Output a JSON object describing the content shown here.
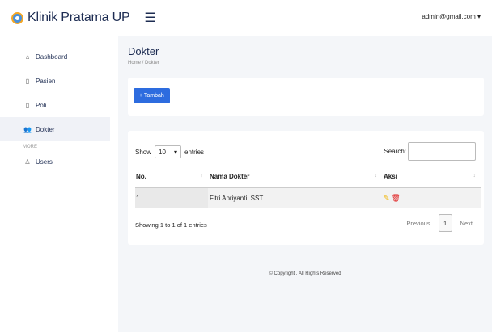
{
  "header": {
    "brand": "Klinik Pratama UP",
    "user": "admin@gmail.com ▾"
  },
  "sidebar": {
    "items": [
      {
        "label": "Dashboard",
        "icon": "home-icon"
      },
      {
        "label": "Pasien",
        "icon": "document-icon"
      },
      {
        "label": "Poli",
        "icon": "document-icon"
      },
      {
        "label": "Dokter",
        "icon": "users-icon"
      }
    ],
    "section": "MORE",
    "more_items": [
      {
        "label": "Users",
        "icon": "user-icon"
      }
    ]
  },
  "main": {
    "title": "Dokter",
    "breadcrumb": "Home  /  Dokter",
    "add_button": "+ Tambah",
    "show_label": "Show",
    "entries_value": "10",
    "entries_label": "entries",
    "search_label": "Search:",
    "table": {
      "headers": [
        "No.",
        "Nama Dokter",
        "Aksi"
      ],
      "rows": [
        {
          "no": "1",
          "name": "Fitri Apriyanti, SST"
        }
      ]
    },
    "info": "Showing 1 to 1 of 1 entries",
    "pagination": {
      "prev": "Previous",
      "current": "1",
      "next": "Next"
    }
  },
  "footer": "© Copyright . All Rights Reserved",
  "colors": {
    "primary": "#2d6cdf",
    "brand_text": "#1d2c52",
    "edit": "#f0b400",
    "delete": "#e02020"
  }
}
